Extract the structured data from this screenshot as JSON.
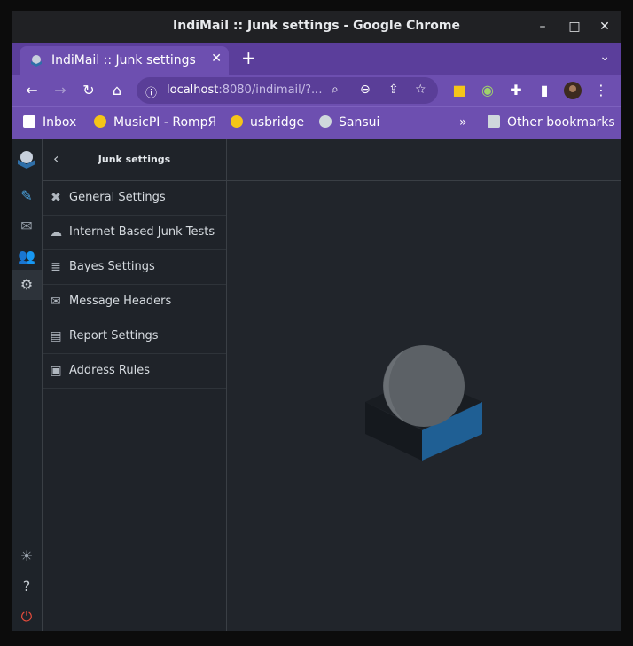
{
  "window": {
    "title": "IndiMail :: Junk settings - Google Chrome",
    "controls": [
      "–",
      "□",
      "✕"
    ]
  },
  "tabs": [
    {
      "label": "IndiMail :: Junk settings",
      "close": "✕"
    }
  ],
  "tab_new": "+",
  "tab_list": "⌄",
  "address": {
    "info_icon": "ⓘ",
    "host": "localhost",
    "rest": ":8080/indimail/?..."
  },
  "bookmarks": [
    {
      "label": "Inbox"
    },
    {
      "label": "MusicPI - RompЯ"
    },
    {
      "label": "usbridge"
    },
    {
      "label": "Sansui"
    }
  ],
  "bookmarks_overflow": "»",
  "other_bookmarks": "Other bookmarks",
  "panel": {
    "back": "‹",
    "title": "Junk settings",
    "items": [
      {
        "label": "General Settings",
        "icon": "tools-icon"
      },
      {
        "label": "Internet Based Junk Tests",
        "icon": "cloud-icon"
      },
      {
        "label": "Bayes Settings",
        "icon": "database-icon"
      },
      {
        "label": "Message Headers",
        "icon": "envelope-icon"
      },
      {
        "label": "Report Settings",
        "icon": "document-icon"
      },
      {
        "label": "Address Rules",
        "icon": "address-card-icon"
      }
    ]
  },
  "colors": {
    "tabstrip": "#5b3e9b",
    "toolbar": "#6d4fb0",
    "accent": "#2f6fa8",
    "logout": "#e74c3c"
  }
}
